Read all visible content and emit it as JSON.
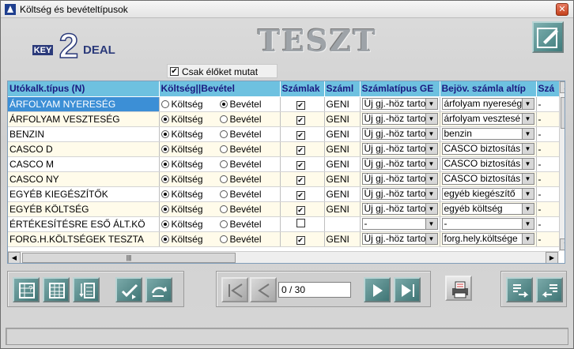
{
  "window": {
    "title": "Költség és bevételtípusok"
  },
  "watermark": "TESZT",
  "logo": {
    "text_left": "KEY",
    "digit": "2",
    "text_right": "DEAL"
  },
  "filter": {
    "label": "Csak élőket mutat",
    "checked": true
  },
  "table": {
    "columns": [
      "Utókalk.típus (N)",
      "Költség||Bevétel",
      "Számlak",
      "Száml",
      "Számlatípus GE",
      "Bejöv. számla altíp",
      "Szá"
    ],
    "radio_labels": [
      "Költség",
      "Bevétel"
    ],
    "rows": [
      {
        "name": "ÁRFOLYAM NYERESÉG",
        "type": "Bevétel",
        "checked": true,
        "code": "GENI",
        "szamlatipus": "Új gj.-höz tarto",
        "altipus": "árfolyam nyereség",
        "last": "-"
      },
      {
        "name": "ÁRFOLYAM VESZTESÉG",
        "type": "Költség",
        "checked": true,
        "code": "GENI",
        "szamlatipus": "Új gj.-höz tarto",
        "altipus": "árfolyam vesztesé",
        "last": "-"
      },
      {
        "name": "BENZIN",
        "type": "Költség",
        "checked": true,
        "code": "GENI",
        "szamlatipus": "Új gj.-höz tarto",
        "altipus": "benzin",
        "last": "-"
      },
      {
        "name": "CASCO D",
        "type": "Költség",
        "checked": true,
        "code": "GENI",
        "szamlatipus": "Új gj.-höz tarto",
        "altipus": "CASCO biztosítás",
        "last": "-"
      },
      {
        "name": "CASCO M",
        "type": "Költség",
        "checked": true,
        "code": "GENI",
        "szamlatipus": "Új gj.-höz tarto",
        "altipus": "CASCO biztosítás",
        "last": "-"
      },
      {
        "name": "CASCO NY",
        "type": "Költség",
        "checked": true,
        "code": "GENI",
        "szamlatipus": "Új gj.-höz tarto",
        "altipus": "CASCO biztosítás",
        "last": "-"
      },
      {
        "name": "EGYÉB KIEGÉSZÍTŐK",
        "type": "Költség",
        "checked": true,
        "code": "GENI",
        "szamlatipus": "Új gj.-höz tarto",
        "altipus": "egyéb kiegészítő",
        "last": "-"
      },
      {
        "name": "EGYÉB KÖLTSÉG",
        "type": "Költség",
        "checked": true,
        "code": "GENI",
        "szamlatipus": "Új gj.-höz tarto",
        "altipus": "egyéb költség",
        "last": "-"
      },
      {
        "name": "ÉRTÉKESÍTÉSRE ESŐ ÁLT.KÖ",
        "type": "Költség",
        "checked": false,
        "code": "",
        "szamlatipus": "-",
        "altipus": "-",
        "last": "-"
      },
      {
        "name": "FORG.H.KÖLTSÉGEK TESZTA",
        "type": "Költség",
        "checked": true,
        "code": "GENI",
        "szamlatipus": "Új gj.-höz tarto",
        "altipus": "forg.hely.költsége",
        "last": "-"
      }
    ]
  },
  "pager": {
    "position": "0 / 30"
  },
  "toolbar": {
    "left": [
      "grid-edit-icon",
      "grid-view-icon",
      "list-sort-icon",
      "check-arrow-icon",
      "refresh-icon"
    ],
    "nav": [
      "first-icon",
      "prev-icon",
      "next-icon",
      "last-icon"
    ],
    "print": "print-icon",
    "right": [
      "export-icon",
      "import-icon"
    ]
  },
  "colors": {
    "header_bg": "#6ec1e0",
    "header_text": "#1a1a80",
    "selected_row": "#3c8fd6",
    "row_alt": "#fffbea",
    "button_teal": "#4f8a8a"
  }
}
